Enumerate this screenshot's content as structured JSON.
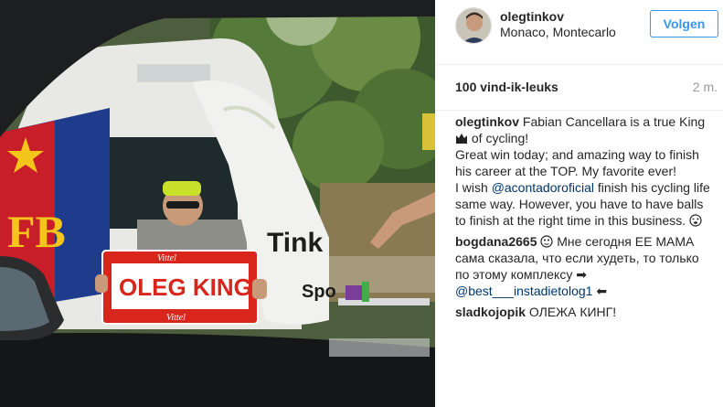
{
  "post": {
    "username": "olegtinkov",
    "location": "Monaco, Montecarlo",
    "follow_label": "Volgen",
    "likes": "100 vind-ik-leuks",
    "time": "2 m."
  },
  "photo": {
    "sign_text": "OLEG KING",
    "sign_brand_top": "Vittel",
    "sign_brand_bottom": "Vittel",
    "flag_text": "Tink",
    "flag_text2": "Spo"
  },
  "caption": {
    "author": "olegtinkov",
    "part1": "Fabian Cancellara is a true King",
    "part2": "of cycling!",
    "part3": "Great win today; and amazing way to finish his career at the TOP. My favorite ever!",
    "part4": "I wish",
    "mention": "@acontadoroficial",
    "part5": "finish his cycling life same way. However, you have to have balls to finish at the right time in this business.",
    "crown_icon": "crown-icon",
    "wink_icon": "wink-emoji-icon"
  },
  "comments": [
    {
      "author": "bogdana2665",
      "text": "Мне сегодня ЕЕ МАМА сама сказала, что если худеть, то только по этому комплексу ➡",
      "mention": "@best___instadietolog1",
      "after": "⬅"
    },
    {
      "author": "sladkojopik",
      "text": "ОЛЕЖА КИНГ!"
    }
  ],
  "colors": {
    "accent": "#3897f0",
    "mention": "#003569",
    "sign_red": "#d9261c"
  }
}
